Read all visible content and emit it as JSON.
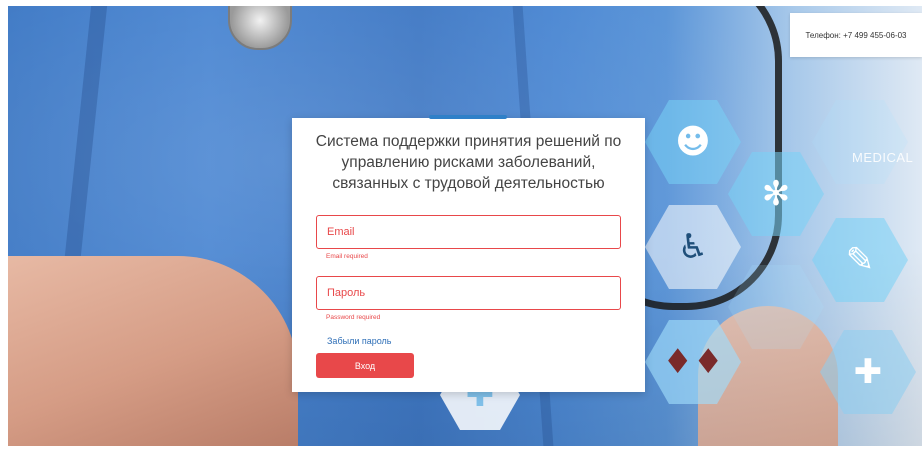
{
  "header": {
    "phone_text": "Телефон: +7 499 455-06-03"
  },
  "background": {
    "medical_label": "MEDICAL"
  },
  "login": {
    "title": "Система поддержки принятия решений по управлению рисками заболеваний, связанных с трудовой деятельностью",
    "email_placeholder": "Email",
    "email_error": "Email required",
    "password_placeholder": "Пароль",
    "password_error": "Password required",
    "forgot_link": "Забыли пароль",
    "submit_label": "Вход"
  },
  "colors": {
    "accent": "#e8484a",
    "link": "#2f6fb7",
    "tab": "#2f80c8"
  },
  "icons": [
    "people-icon",
    "molecule-icon",
    "wheelchair-icon",
    "blood-drops-icon",
    "syringe-icon",
    "medkit-icon",
    "world-map-icon",
    "medical-cross-icon"
  ]
}
